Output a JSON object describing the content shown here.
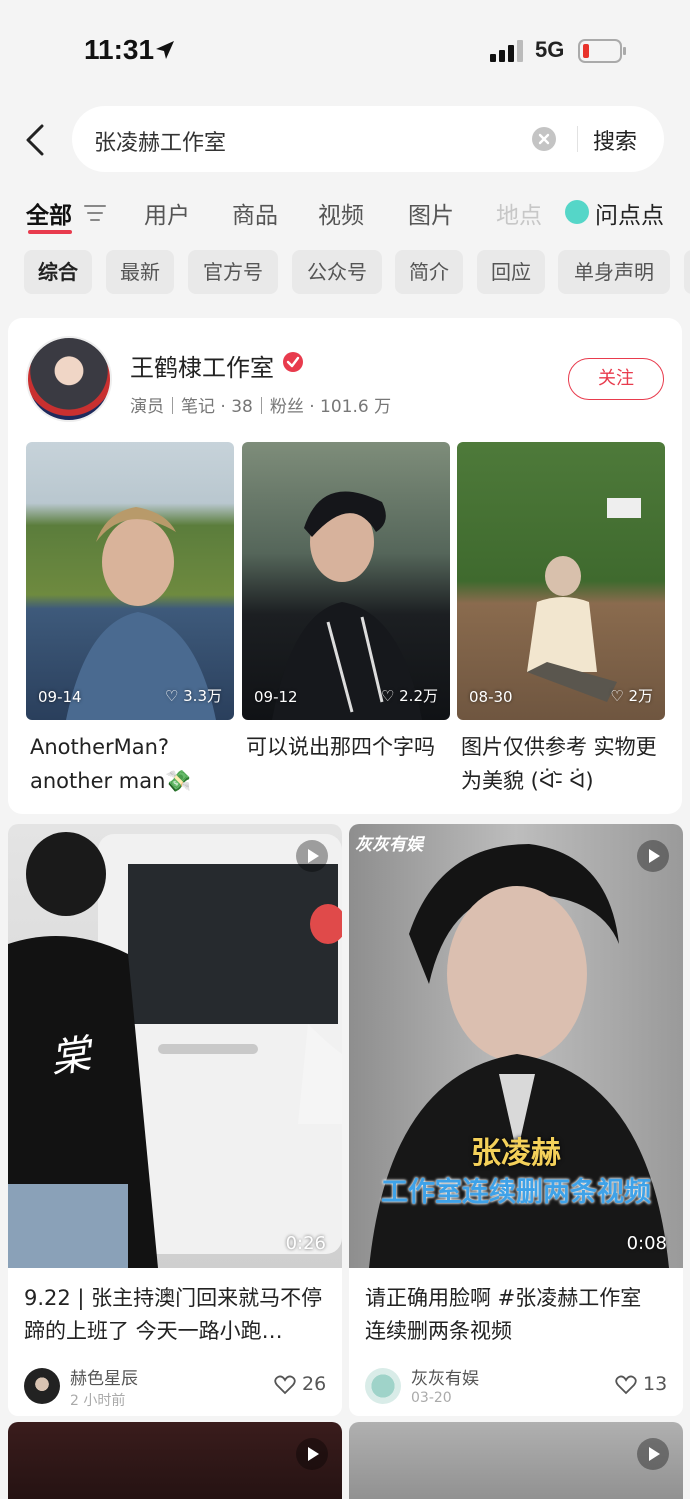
{
  "status_bar": {
    "time": "11:31",
    "network": "5G"
  },
  "search": {
    "query": "张凌赫工作室",
    "button": "搜索"
  },
  "tabs": [
    {
      "label": "全部"
    },
    {
      "label": "用户"
    },
    {
      "label": "商品"
    },
    {
      "label": "视频"
    },
    {
      "label": "图片"
    },
    {
      "label": "地点"
    },
    {
      "label": "问点点"
    }
  ],
  "chips": [
    "综合",
    "最新",
    "官方号",
    "公众号",
    "简介",
    "回应",
    "单身声明"
  ],
  "user_card": {
    "name": "王鹤棣工作室",
    "meta": "演员｜笔记 · 38｜粉丝 · 101.6 万",
    "follow": "关注",
    "posts": [
      {
        "date": "09-14",
        "likes": "♡ 3.3万",
        "title": "AnotherMan? another man💸"
      },
      {
        "date": "09-12",
        "likes": "♡ 2.2万",
        "title": "可以说出那四个字吗"
      },
      {
        "date": "08-30",
        "likes": "♡ 2万",
        "title": "图片仅供参考 实物更为美貌 (ᐛ-᷅ ᐛ)"
      }
    ]
  },
  "feed": [
    {
      "duration": "0:26",
      "title": "9.22 | 张主持澳门回来就马不停蹄的上班了 今天一路小跑…",
      "author": "赫色星辰",
      "time": "2 小时前",
      "likes": "26",
      "shirt_text": "棠"
    },
    {
      "watermark": "灰灰有娱",
      "overlay_name": "张凌赫",
      "overlay_caption": "工作室连续删两条视频",
      "duration": "0:08",
      "title": "请正确用脸啊 #张凌赫工作室 连续删两条视频",
      "author": "灰灰有娱",
      "time": "03-20",
      "likes": "13"
    }
  ]
}
